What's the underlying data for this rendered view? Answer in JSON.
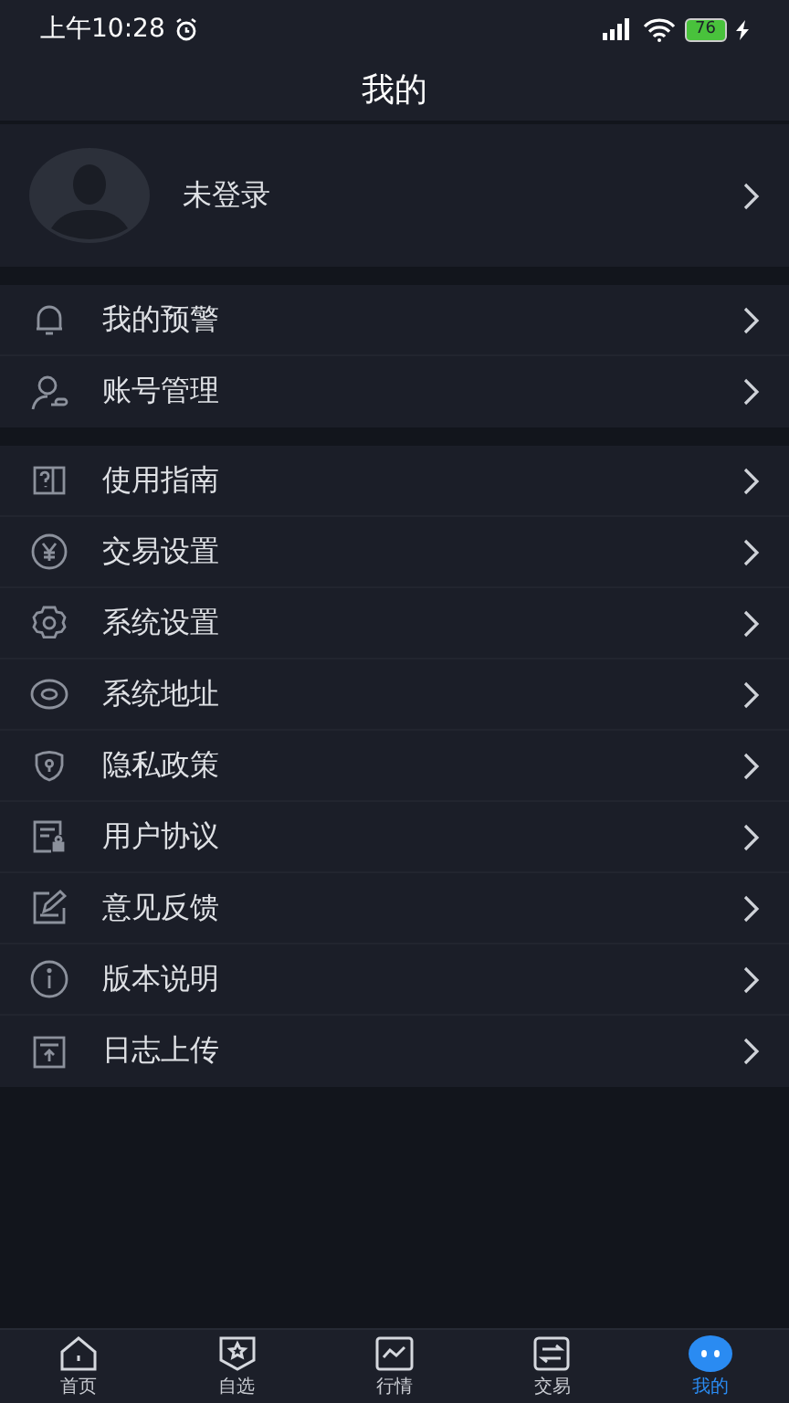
{
  "status_bar": {
    "time": "上午10:28",
    "battery": "76"
  },
  "title": "我的",
  "profile": {
    "name": "未登录"
  },
  "groups": [
    {
      "items": [
        {
          "label": "我的预警"
        },
        {
          "label": "账号管理"
        }
      ]
    },
    {
      "items": [
        {
          "label": "使用指南"
        },
        {
          "label": "交易设置"
        },
        {
          "label": "系统设置"
        },
        {
          "label": "系统地址"
        },
        {
          "label": "隐私政策"
        },
        {
          "label": "用户协议"
        },
        {
          "label": "意见反馈"
        },
        {
          "label": "版本说明"
        },
        {
          "label": "日志上传"
        }
      ]
    }
  ],
  "tabs": [
    {
      "label": "首页",
      "selected": false
    },
    {
      "label": "自选",
      "selected": false
    },
    {
      "label": "行情",
      "selected": false
    },
    {
      "label": "交易",
      "selected": false
    },
    {
      "label": "我的",
      "selected": true
    }
  ]
}
